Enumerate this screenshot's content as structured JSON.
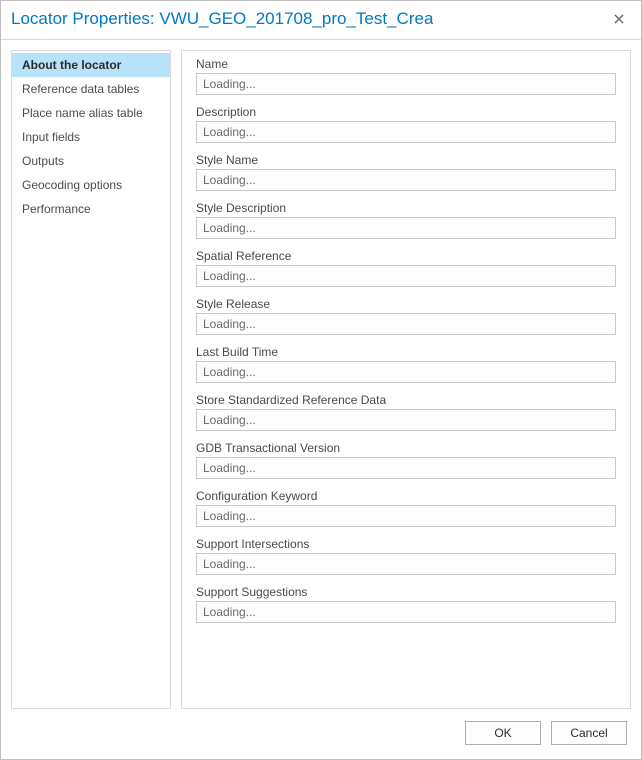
{
  "window": {
    "title": "Locator Properties: VWU_GEO_201708_pro_Test_Crea"
  },
  "sidebar": {
    "items": [
      {
        "label": "About the locator",
        "active": true
      },
      {
        "label": "Reference data tables",
        "active": false
      },
      {
        "label": "Place name alias table",
        "active": false
      },
      {
        "label": "Input fields",
        "active": false
      },
      {
        "label": "Outputs",
        "active": false
      },
      {
        "label": "Geocoding options",
        "active": false
      },
      {
        "label": "Performance",
        "active": false
      }
    ]
  },
  "main": {
    "fields": [
      {
        "label": "Name",
        "value": "Loading..."
      },
      {
        "label": "Description",
        "value": "Loading..."
      },
      {
        "label": "Style Name",
        "value": "Loading..."
      },
      {
        "label": "Style Description",
        "value": "Loading..."
      },
      {
        "label": "Spatial Reference",
        "value": "Loading..."
      },
      {
        "label": "Style Release",
        "value": "Loading..."
      },
      {
        "label": "Last Build Time",
        "value": "Loading..."
      },
      {
        "label": "Store Standardized Reference Data",
        "value": "Loading..."
      },
      {
        "label": "GDB Transactional Version",
        "value": "Loading..."
      },
      {
        "label": "Configuration Keyword",
        "value": "Loading..."
      },
      {
        "label": "Support Intersections",
        "value": "Loading..."
      },
      {
        "label": "Support Suggestions",
        "value": "Loading..."
      }
    ]
  },
  "footer": {
    "ok_label": "OK",
    "cancel_label": "Cancel"
  }
}
